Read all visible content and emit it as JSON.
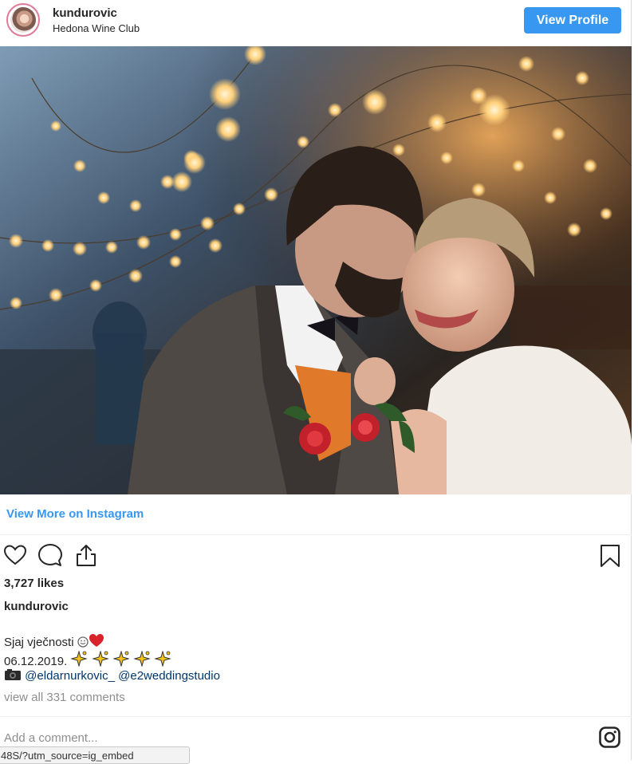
{
  "header": {
    "username": "kundurovic",
    "location": "Hedona Wine Club",
    "view_profile_label": "View Profile"
  },
  "post": {
    "view_more_label": "View More on Instagram",
    "likes": "3,727 likes",
    "owner": "kundurovic",
    "caption": {
      "line1_text": "Sjaj vječnosti ",
      "line2_text": "06.12.2019. ",
      "line3_mention1": "@eldarnurkovic_",
      "line3_mention2": "@e2weddingstudio"
    },
    "comments_link": "view all 331 comments",
    "add_comment_placeholder": "Add a comment..."
  },
  "status_tip": {
    "url": "48S/?utm_source=ig_embed"
  },
  "icons": {
    "like": "heart-icon",
    "comment": "comment-icon",
    "share": "share-icon",
    "save": "bookmark-icon",
    "instagram": "instagram-icon",
    "camera_emoji": "camera-emoji-icon",
    "heart_emoji": "red-heart-emoji-icon",
    "sparkle_emoji": "sparkle-emoji-icon"
  },
  "colors": {
    "accent": "#3897f0",
    "text": "#262626",
    "muted": "#8e8e8e",
    "mention": "#00376b"
  }
}
